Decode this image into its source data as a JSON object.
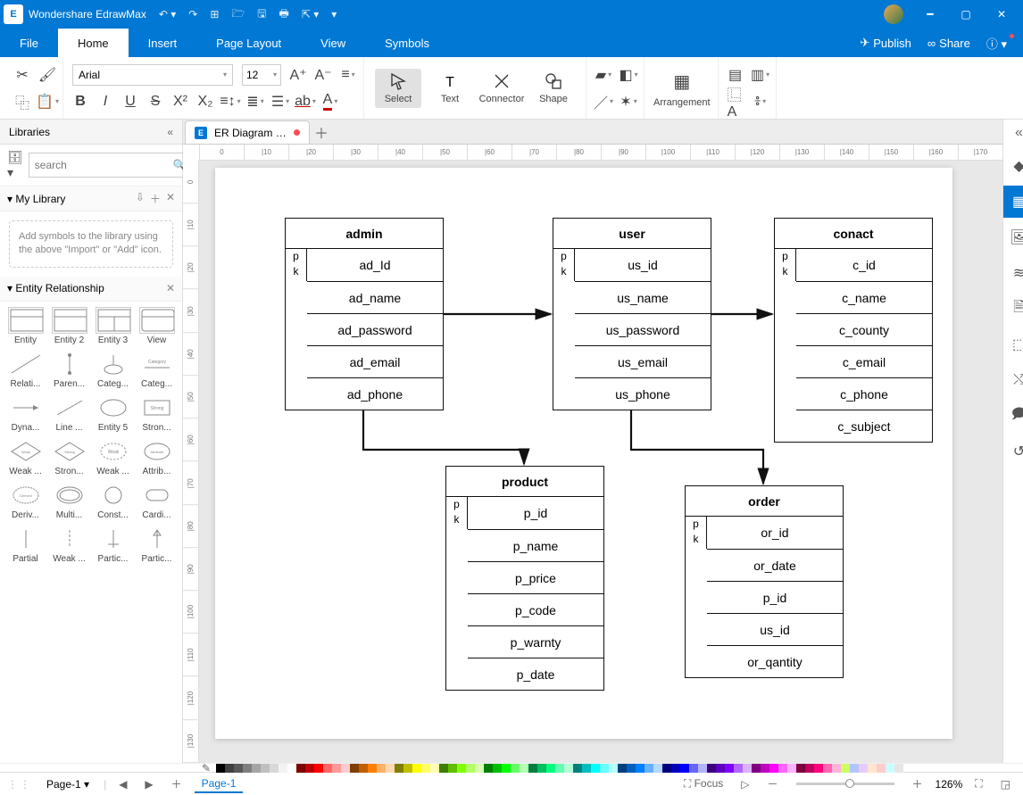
{
  "titlebar": {
    "app_name": "Wondershare EdrawMax"
  },
  "menubar": {
    "items": [
      "File",
      "Home",
      "Insert",
      "Page Layout",
      "View",
      "Symbols"
    ],
    "active": "Home",
    "publish": "Publish",
    "share": "Share"
  },
  "ribbon": {
    "font_name": "Arial",
    "font_size": "12",
    "tools": {
      "select": "Select",
      "text": "Text",
      "connector": "Connector",
      "shape": "Shape"
    },
    "arrangement": "Arrangement"
  },
  "sidebar": {
    "title": "Libraries",
    "search_placeholder": "search",
    "mylib": "My Library",
    "hint": "Add symbols to the library using the above \"Import\" or \"Add\" icon.",
    "entity_rel": "Entity Relationship",
    "shapes": [
      "Entity",
      "Entity 2",
      "Entity 3",
      "View",
      "Relati...",
      "Paren...",
      "Categ...",
      "Categ...",
      "Dyna...",
      "Line ...",
      "Entity 5",
      "Stron...",
      "Weak ...",
      "Stron...",
      "Weak ...",
      "Attrib...",
      "Deriv...",
      "Multi...",
      "Const...",
      "Cardi...",
      "Partial",
      "Weak ...",
      "Partic...",
      "Partic..."
    ]
  },
  "document": {
    "tab_title": "ER Diagram for ...",
    "page_name": "Page-1",
    "tables": {
      "admin": {
        "title": "admin",
        "pk": "pk",
        "rows": [
          "ad_Id",
          "ad_name",
          "ad_password",
          "ad_email",
          "ad_phone"
        ]
      },
      "user": {
        "title": "user",
        "pk": "pk",
        "rows": [
          "us_id",
          "us_name",
          "us_password",
          "us_email",
          "us_phone"
        ]
      },
      "conact": {
        "title": "conact",
        "pk": "pk",
        "rows": [
          "c_id",
          "c_name",
          "c_county",
          "c_email",
          "c_phone",
          "c_subject"
        ]
      },
      "product": {
        "title": "product",
        "pk": "pk",
        "rows": [
          "p_id",
          "p_name",
          "p_price",
          "p_code",
          "p_warnty",
          "p_date"
        ]
      },
      "order": {
        "title": "order",
        "pk": "pk",
        "rows": [
          "or_id",
          "or_date",
          "p_id",
          "us_id",
          "or_qantity"
        ]
      }
    }
  },
  "ruler_h": [
    "0",
    "|10",
    "|20",
    "|30",
    "|40",
    "|50",
    "|60",
    "|70",
    "|80",
    "|90",
    "|100",
    "|110",
    "|120",
    "|130",
    "|140",
    "|150",
    "|160",
    "|170"
  ],
  "ruler_v": [
    "0",
    "|10",
    "|20",
    "|30",
    "|40",
    "|50",
    "|60",
    "|70",
    "|80",
    "|90",
    "|100",
    "|110",
    "|120",
    "|130"
  ],
  "statusbar": {
    "focus": "Focus",
    "zoom": "126%"
  },
  "colors": [
    "#000000",
    "#3f3f3f",
    "#595959",
    "#7f7f7f",
    "#a5a5a5",
    "#bfbfbf",
    "#d8d8d8",
    "#f2f2f2",
    "#ffffff",
    "#7f0000",
    "#c00000",
    "#ff0000",
    "#ff6666",
    "#ff9999",
    "#ffcccc",
    "#7f3f00",
    "#bf5f00",
    "#ff7f00",
    "#ffb266",
    "#ffd9b3",
    "#7f7f00",
    "#bfbf00",
    "#ffff00",
    "#ffff66",
    "#ffffb3",
    "#3f7f00",
    "#5fbf00",
    "#7fff00",
    "#b2ff66",
    "#d9ffb3",
    "#007f00",
    "#00bf00",
    "#00ff00",
    "#66ff66",
    "#b3ffb3",
    "#007f3f",
    "#00bf5f",
    "#00ff7f",
    "#66ffb2",
    "#b3ffd9",
    "#007f7f",
    "#00bfbf",
    "#00ffff",
    "#66ffff",
    "#b3ffff",
    "#003f7f",
    "#005fbf",
    "#007fff",
    "#66b2ff",
    "#b3d9ff",
    "#00007f",
    "#0000bf",
    "#0000ff",
    "#6666ff",
    "#b3b3ff",
    "#3f007f",
    "#5f00bf",
    "#7f00ff",
    "#b266ff",
    "#d9b3ff",
    "#7f007f",
    "#bf00bf",
    "#ff00ff",
    "#ff66ff",
    "#ffb3ff",
    "#7f003f",
    "#bf005f",
    "#ff007f",
    "#ff66b2",
    "#ffb3d9",
    "#ccff66",
    "#b3c6ff",
    "#e6ccff",
    "#ffe6cc",
    "#ffcccc",
    "#ccffff",
    "#e6e6e6"
  ]
}
